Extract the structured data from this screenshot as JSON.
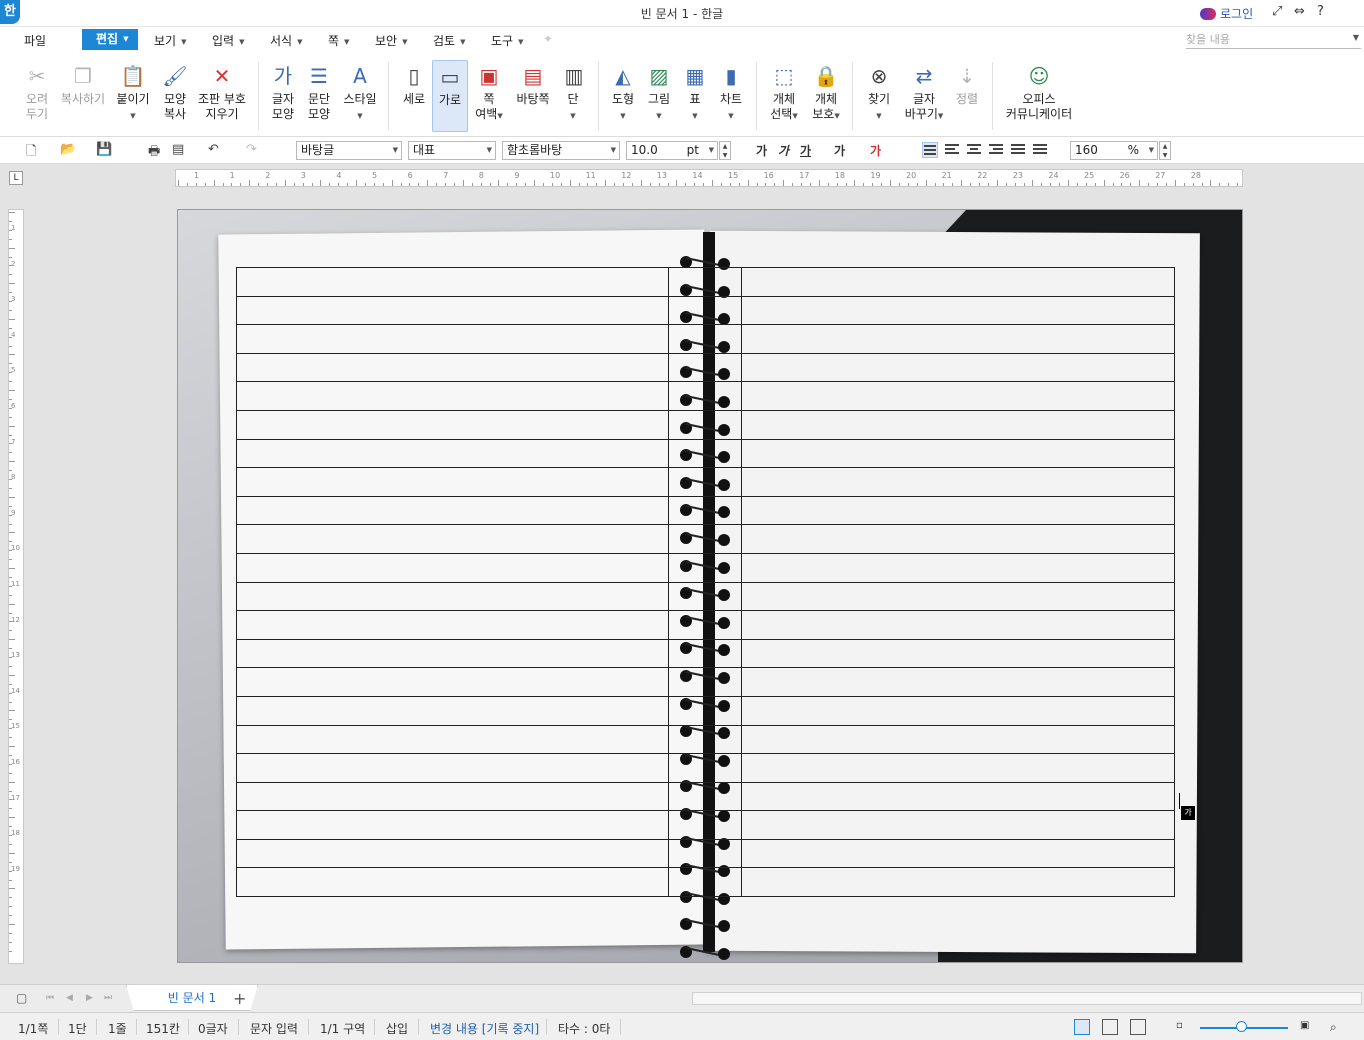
{
  "titlebar": {
    "app_icon": "한",
    "title": "빈 문서 1 - 한글",
    "login": "로그인",
    "controls": [
      "⤢",
      "⇔",
      "?"
    ]
  },
  "menubar": {
    "file": "파일",
    "items": [
      "편집",
      "보기",
      "입력",
      "서식",
      "쪽",
      "보안",
      "검토",
      "도구"
    ],
    "search_placeholder": "찾을 내용"
  },
  "ribbon": {
    "cut": [
      "오려",
      "두기"
    ],
    "copy": "복사하기",
    "paste": "붙이기",
    "format_copy": [
      "모양",
      "복사"
    ],
    "erase_marks": [
      "조판 부호",
      "지우기"
    ],
    "char_shape": [
      "글자",
      "모양"
    ],
    "para_shape": [
      "문단",
      "모양"
    ],
    "style": "스타일",
    "vertical": "세로",
    "horizontal": "가로",
    "margin": [
      "쪽",
      "여백"
    ],
    "background_page": "바탕쪽",
    "columns": "단",
    "shapes": "도형",
    "picture": "그림",
    "table": "표",
    "chart": "차트",
    "object_select": [
      "개체",
      "선택"
    ],
    "object_protect": [
      "개체",
      "보호"
    ],
    "find": "찾기",
    "replace": [
      "글자",
      "바꾸기"
    ],
    "sort": "정렬",
    "office_comm": [
      "오피스",
      "커뮤니케이터"
    ]
  },
  "toolbar": {
    "style": "바탕글",
    "lang": "대표",
    "font": "함초롬바탕",
    "size": "10.0",
    "unit": "pt",
    "zoom": "160",
    "zoom_unit": "%",
    "fmt_buttons": [
      "가",
      "가",
      "가",
      "가",
      "가"
    ]
  },
  "hruler_labels": [
    "1",
    "1",
    "2",
    "3",
    "4",
    "5",
    "6",
    "7",
    "8",
    "9",
    "10",
    "11",
    "12",
    "13",
    "14",
    "15",
    "16",
    "17",
    "18",
    "19",
    "20",
    "21",
    "22",
    "23",
    "24",
    "25",
    "26",
    "27",
    "28"
  ],
  "vruler_labels": [
    "1",
    "2",
    "3",
    "4",
    "5",
    "6",
    "7",
    "8",
    "9",
    "10",
    "11",
    "12",
    "13",
    "14",
    "15",
    "16",
    "17",
    "18",
    "19"
  ],
  "document": {
    "rows": 22,
    "cols": 3,
    "cursor_tag": "가"
  },
  "tabs": {
    "current": "빈 문서 1",
    "add": "+"
  },
  "statusbar": {
    "page": "1/1쪽",
    "column": "1단",
    "line": "1줄",
    "char": "151칸",
    "chars": "0글자",
    "mode": "문자 입력",
    "section": "1/1 구역",
    "insert": "삽입",
    "track": "변경 내용 [기록 중지]",
    "typing": "타수 : 0타"
  }
}
